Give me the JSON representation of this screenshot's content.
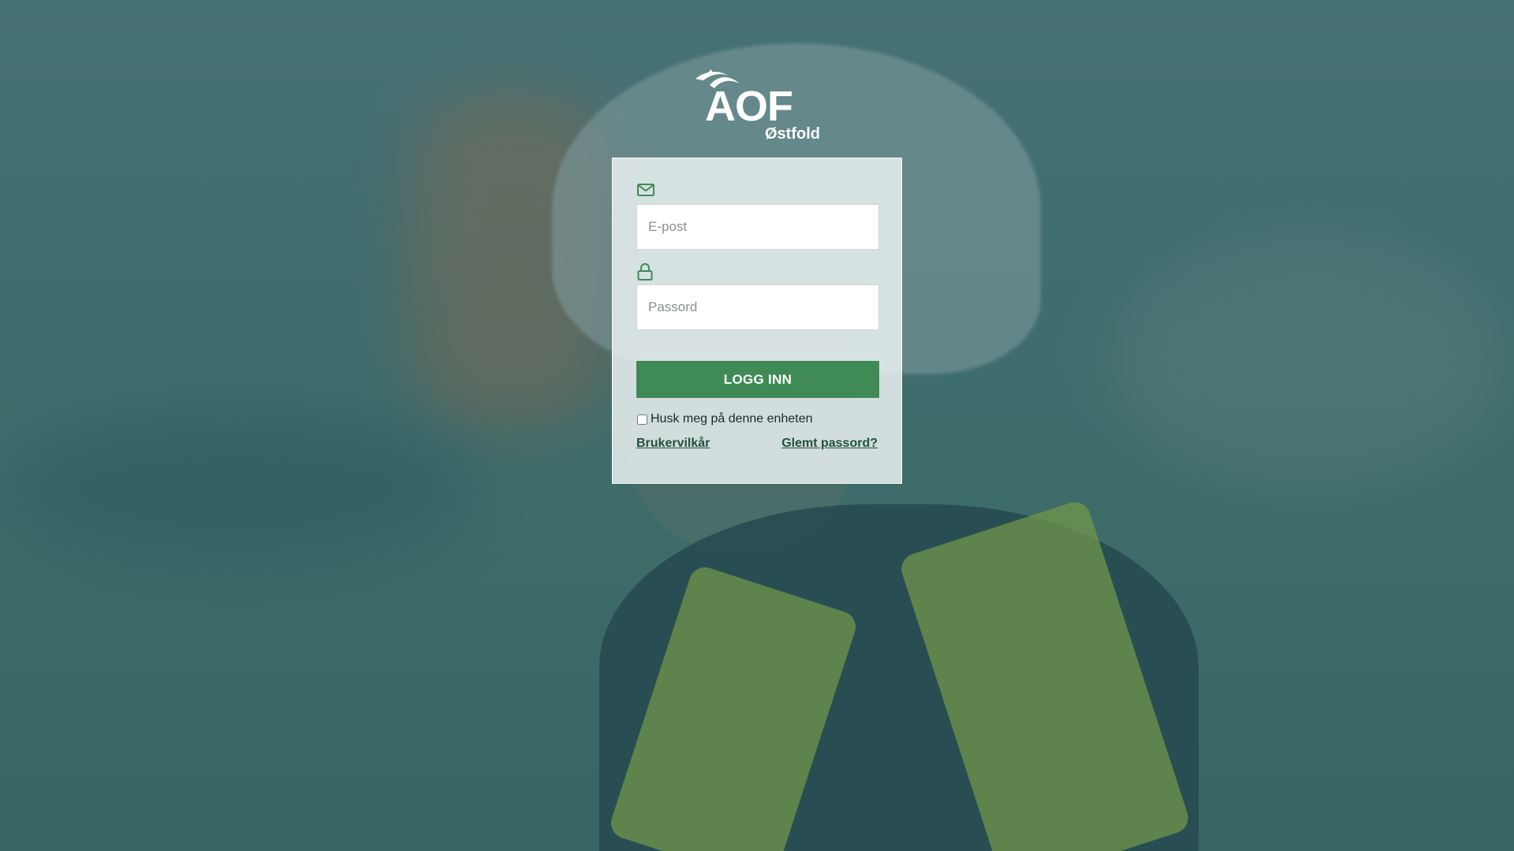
{
  "logo": {
    "main": "AOF",
    "sub": "Østfold"
  },
  "icons": {
    "email": "envelope-icon",
    "password": "lock-icon",
    "logo_mark": "bird-swoosh-icon"
  },
  "form": {
    "email_placeholder": "E-post",
    "password_placeholder": "Passord",
    "login_label": "LOGG INN",
    "remember_label": "Husk meg på denne enheten",
    "remember_checked": false
  },
  "links": {
    "terms": "Brukervilkår",
    "forgot": "Glemt passord?"
  },
  "colors": {
    "primary": "#3f8a55",
    "link": "#21523a",
    "overlay": "#2e5c60"
  }
}
